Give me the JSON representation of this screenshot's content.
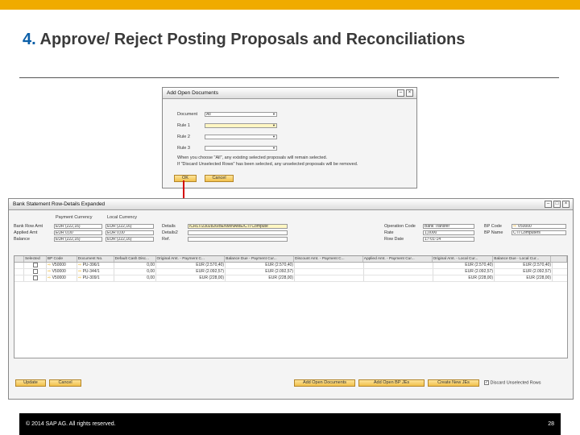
{
  "slide": {
    "title_number": "4.",
    "title_text": " Approve/ Reject Posting Proposals and Reconciliations",
    "footer_copyright": "© 2014 SAP AG. All rights reserved.",
    "page_number": "28"
  },
  "dialog": {
    "title": "Add Open Documents",
    "document_label": "Document",
    "document_value": "All",
    "rule1_label": "Rule 1",
    "rule2_label": "Rule 2",
    "rule3_label": "Rule 3",
    "note1": "When you choose \"All\", any existing selected proposals will remain selected.",
    "note2": "If \"Discard Unselected Rows\" has been selected, any unselected proposals will be removed.",
    "ok_label": "OK",
    "cancel_label": "Cancel"
  },
  "main": {
    "title": "Bank Statement Row-Details Expanded",
    "col_payment_currency": "Payment Currency",
    "col_local_currency": "Local Currency",
    "rows": [
      {
        "label": "Bank Row Amt",
        "pay": "EUR (222,16)",
        "loc": "EUR (222,16)"
      },
      {
        "label": "Applied Amt",
        "pay": "EUR 0,00",
        "loc": "EUR 0,00"
      },
      {
        "label": "Balance",
        "pay": "EUR (222,16)",
        "loc": "EUR (222,16)"
      }
    ],
    "details_label": "Details",
    "details_value": "/CRLT/2302826/BENM/NAME/CTI Compute",
    "details2_label": "Details2",
    "ref_label": "Ref.",
    "operation_code_label": "Operation Code",
    "operation_code_value": "Bank Transfer",
    "rate_label": "Rate",
    "rate_value": "1,0000",
    "row_date_label": "Row Date",
    "row_date_value": "17-01-14",
    "bp_code_label": "BP Code",
    "bp_code_value": "V50000",
    "bp_name_label": "BP Name",
    "bp_name_value": "CTI Computers"
  },
  "grid": {
    "headers": [
      "",
      "Selected",
      "BP Code",
      "Document No.",
      "Default Cash Disc...",
      "Original Amt. - Payment C...",
      "Balance Due - Payment Cur...",
      "Discount Amt. - Payment C...",
      "Applied Amt. - Payment Cur...",
      "Original Amt. - Local Cur...",
      "Balance Due - Local Cur..."
    ],
    "rows": [
      {
        "bp": "V50000",
        "doc": "PU-396/1",
        "disc": "0,00",
        "orig_pay": "EUR (2.570,40)",
        "bal_pay": "EUR (2.570,40)",
        "disc_pay": "",
        "appl_pay": "",
        "orig_loc": "EUR (2.570,40)",
        "bal_loc": "EUR (2.570,40)"
      },
      {
        "bp": "V50000",
        "doc": "PU-344/1",
        "disc": "0,00",
        "orig_pay": "EUR (2.092,57)",
        "bal_pay": "EUR (2.092,57)",
        "disc_pay": "",
        "appl_pay": "",
        "orig_loc": "EUR (2.092,57)",
        "bal_loc": "EUR (2.092,57)"
      },
      {
        "bp": "V50000",
        "doc": "PU-309/1",
        "disc": "0,00",
        "orig_pay": "EUR (228,00)",
        "bal_pay": "EUR (228,00)",
        "disc_pay": "",
        "appl_pay": "",
        "orig_loc": "EUR (228,00)",
        "bal_loc": "EUR (228,00)"
      }
    ]
  },
  "buttons": {
    "update": "Update",
    "cancel": "Cancel",
    "add_open_documents": "Add Open Documents",
    "add_open_bp_jes": "Add Open BP JEs",
    "create_new_jes": "Create New JEs",
    "discard_unselected": "Discard Unselected Rows"
  },
  "colors": {
    "accent_bar": "#f0ab00",
    "title_number": "#0b5fa8",
    "arrow": "#d40000"
  }
}
